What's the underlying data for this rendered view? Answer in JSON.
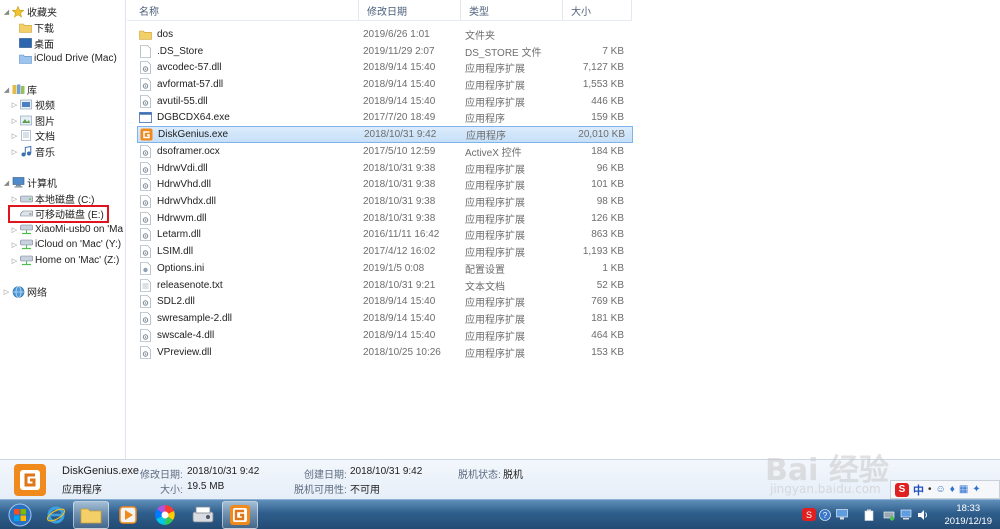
{
  "nav": {
    "favorites": "收藏夹",
    "downloads": "下载",
    "desktop": "桌面",
    "icloud_drive": "iCloud Drive (Mac)",
    "libraries": "库",
    "videos": "视频",
    "pictures": "图片",
    "documents": "文档",
    "music": "音乐",
    "computer": "计算机",
    "local_disk": "本地磁盘 (C:)",
    "removable_disk": "可移动磁盘 (E:)",
    "xiaomi": "XiaoMi-usb0 on 'Ma",
    "icloud_on_mac": "iCloud on 'Mac' (Y:)",
    "home_on_mac": "Home on 'Mac' (Z:)",
    "network": "网络"
  },
  "columns": {
    "name": "名称",
    "date": "修改日期",
    "type": "类型",
    "size": "大小"
  },
  "files": [
    {
      "name": "dos",
      "date": "2019/6/26 1:01",
      "type": "文件夹",
      "size": "",
      "icon": "folder-icon"
    },
    {
      "name": ".DS_Store",
      "date": "2019/11/29 2:07",
      "type": "DS_STORE 文件",
      "size": "7 KB",
      "icon": "file-icon"
    },
    {
      "name": "avcodec-57.dll",
      "date": "2018/9/14 15:40",
      "type": "应用程序扩展",
      "size": "7,127 KB",
      "icon": "dll-icon"
    },
    {
      "name": "avformat-57.dll",
      "date": "2018/9/14 15:40",
      "type": "应用程序扩展",
      "size": "1,553 KB",
      "icon": "dll-icon"
    },
    {
      "name": "avutil-55.dll",
      "date": "2018/9/14 15:40",
      "type": "应用程序扩展",
      "size": "446 KB",
      "icon": "dll-icon"
    },
    {
      "name": "DGBCDX64.exe",
      "date": "2017/7/20 18:49",
      "type": "应用程序",
      "size": "159 KB",
      "icon": "exe-icon"
    },
    {
      "name": "DiskGenius.exe",
      "date": "2018/10/31 9:42",
      "type": "应用程序",
      "size": "20,010 KB",
      "icon": "diskgenius-icon"
    },
    {
      "name": "dsoframer.ocx",
      "date": "2017/5/10 12:59",
      "type": "ActiveX 控件",
      "size": "184 KB",
      "icon": "dll-icon"
    },
    {
      "name": "HdrwVdi.dll",
      "date": "2018/10/31 9:38",
      "type": "应用程序扩展",
      "size": "96 KB",
      "icon": "dll-icon"
    },
    {
      "name": "HdrwVhd.dll",
      "date": "2018/10/31 9:38",
      "type": "应用程序扩展",
      "size": "101 KB",
      "icon": "dll-icon"
    },
    {
      "name": "HdrwVhdx.dll",
      "date": "2018/10/31 9:38",
      "type": "应用程序扩展",
      "size": "98 KB",
      "icon": "dll-icon"
    },
    {
      "name": "Hdrwvm.dll",
      "date": "2018/10/31 9:38",
      "type": "应用程序扩展",
      "size": "126 KB",
      "icon": "dll-icon"
    },
    {
      "name": "Letarm.dll",
      "date": "2016/11/11 16:42",
      "type": "应用程序扩展",
      "size": "863 KB",
      "icon": "dll-icon"
    },
    {
      "name": "LSIM.dll",
      "date": "2017/4/12 16:02",
      "type": "应用程序扩展",
      "size": "1,193 KB",
      "icon": "dll-icon"
    },
    {
      "name": "Options.ini",
      "date": "2019/1/5 0:08",
      "type": "配置设置",
      "size": "1 KB",
      "icon": "ini-icon"
    },
    {
      "name": "releasenote.txt",
      "date": "2018/10/31 9:21",
      "type": "文本文档",
      "size": "52 KB",
      "icon": "txt-icon"
    },
    {
      "name": "SDL2.dll",
      "date": "2018/9/14 15:40",
      "type": "应用程序扩展",
      "size": "769 KB",
      "icon": "dll-icon"
    },
    {
      "name": "swresample-2.dll",
      "date": "2018/9/14 15:40",
      "type": "应用程序扩展",
      "size": "181 KB",
      "icon": "dll-icon"
    },
    {
      "name": "swscale-4.dll",
      "date": "2018/9/14 15:40",
      "type": "应用程序扩展",
      "size": "464 KB",
      "icon": "dll-icon"
    },
    {
      "name": "VPreview.dll",
      "date": "2018/10/25 10:26",
      "type": "应用程序扩展",
      "size": "153 KB",
      "icon": "dll-icon"
    }
  ],
  "details": {
    "filename": "DiskGenius.exe",
    "filetype": "应用程序",
    "modified_label": "修改日期:",
    "modified_value": "2018/10/31 9:42",
    "created_label": "创建日期:",
    "created_value": "2018/10/31 9:42",
    "offline_status_label": "脱机状态:",
    "offline_status_value": "脱机",
    "size_label": "大小:",
    "size_value": "19.5 MB",
    "offline_avail_label": "脱机可用性:",
    "offline_avail_value": "不可用"
  },
  "taskbar": {
    "ime_label": "中",
    "clock_time": "18:33",
    "clock_date": "2019/12/19"
  },
  "watermark": {
    "logo": "Bai 经验",
    "url": "jingyan.baidu.com"
  },
  "colors": {
    "selection": "#cce4fa",
    "highlight_box": "#e0141e",
    "taskbar": "#2f5e8c"
  }
}
